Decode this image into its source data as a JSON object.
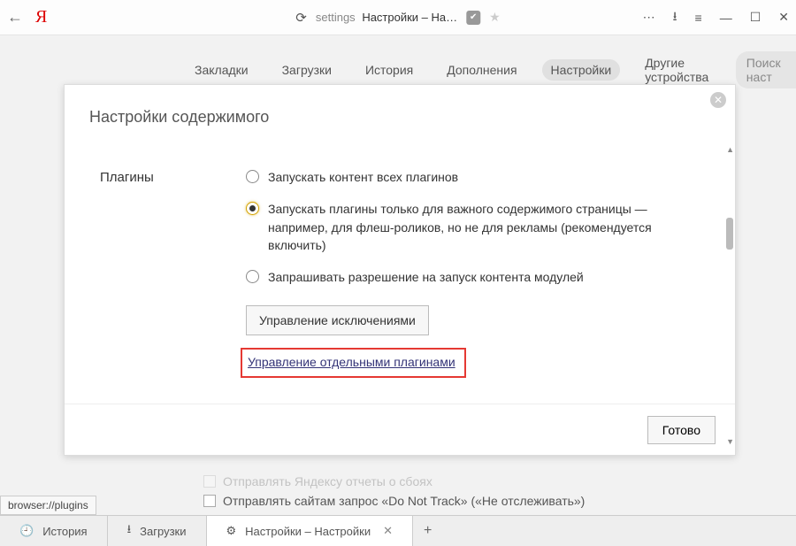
{
  "titlebar": {
    "url_prefix": "settings",
    "title": "Настройки – На…"
  },
  "settings_tabs": {
    "items": [
      "Закладки",
      "Загрузки",
      "История",
      "Дополнения",
      "Настройки",
      "Другие устройства"
    ],
    "active_index": 4,
    "search_placeholder": "Поиск наст"
  },
  "background_rows": {
    "row0": "Отправлять Яндексу отчеты о сбоях",
    "row1": "Отправлять сайтам запрос «Do Not Track» («Не отслеживать»)"
  },
  "modal": {
    "title": "Настройки содержимого",
    "section_label": "Плагины",
    "options": {
      "opt0": "Запускать контент всех плагинов",
      "opt1": "Запускать плагины только для важного содержимого страницы — например, для флеш-роликов, но не для рекламы (рекомендуется включить)",
      "opt2": "Запрашивать разрешение на запуск контента модулей"
    },
    "exceptions_button": "Управление исключениями",
    "plugins_link": "Управление отдельными плагинами",
    "done_button": "Готово"
  },
  "status_url": "browser://plugins",
  "tabstrip": {
    "tab0": "История",
    "tab1": "Загрузки",
    "tab2": "Настройки – Настройки"
  }
}
